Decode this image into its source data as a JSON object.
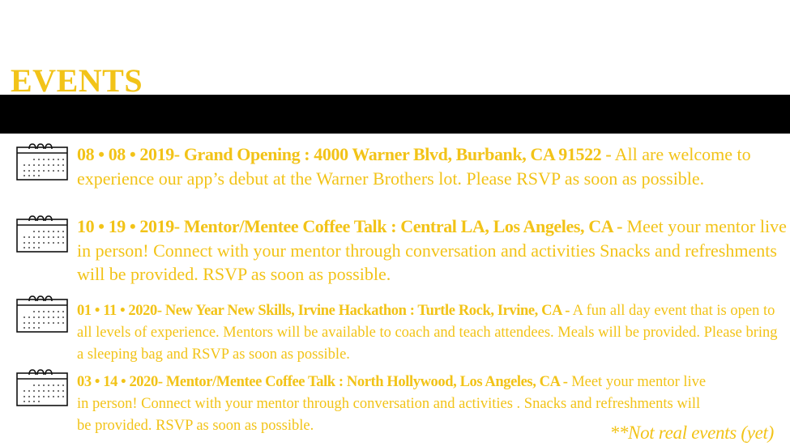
{
  "page": {
    "title": "EVENTS",
    "note": "**Not real events (yet)"
  },
  "colors": {
    "accent": "#f2c318",
    "band": "#000000",
    "background": "#ffffff"
  },
  "events": [
    {
      "icon": "calendar-icon",
      "heading": "08 • 08 • 2019- Grand  Opening : 4000 Warner Blvd, Burbank, CA 91522 -",
      "description": "All are welcome to experience our app’s debut at the Warner Brothers lot. Please RSVP as soon as possible."
    },
    {
      "icon": "calendar-icon",
      "heading": "10 • 19 • 2019- Mentor/Mentee Coffee Talk : Central LA, Los Angeles, CA -",
      "description": "Meet your mentor live in person! Connect with your mentor through conversation and activities Snacks and refreshments will be provided. RSVP as soon as possible."
    },
    {
      "icon": "calendar-icon",
      "heading": "01 • 11 • 2020- New Year New Skills, Irvine Hackathon  : Turtle Rock, Irvine, CA -",
      "description": "A fun all day event that is open to all levels of experience. Mentors will be available to coach and teach attendees. Meals will be provided. Please bring a sleeping bag and RSVP as soon as possible."
    },
    {
      "icon": "calendar-icon",
      "heading": "03 • 14 • 2020- Mentor/Mentee Coffee Talk : North Hollywood, Los Angeles, CA -",
      "description": "Meet your mentor live in person! Connect with your mentor through conversation and activities . Snacks and refreshments will be provided. RSVP as soon as possible."
    }
  ]
}
